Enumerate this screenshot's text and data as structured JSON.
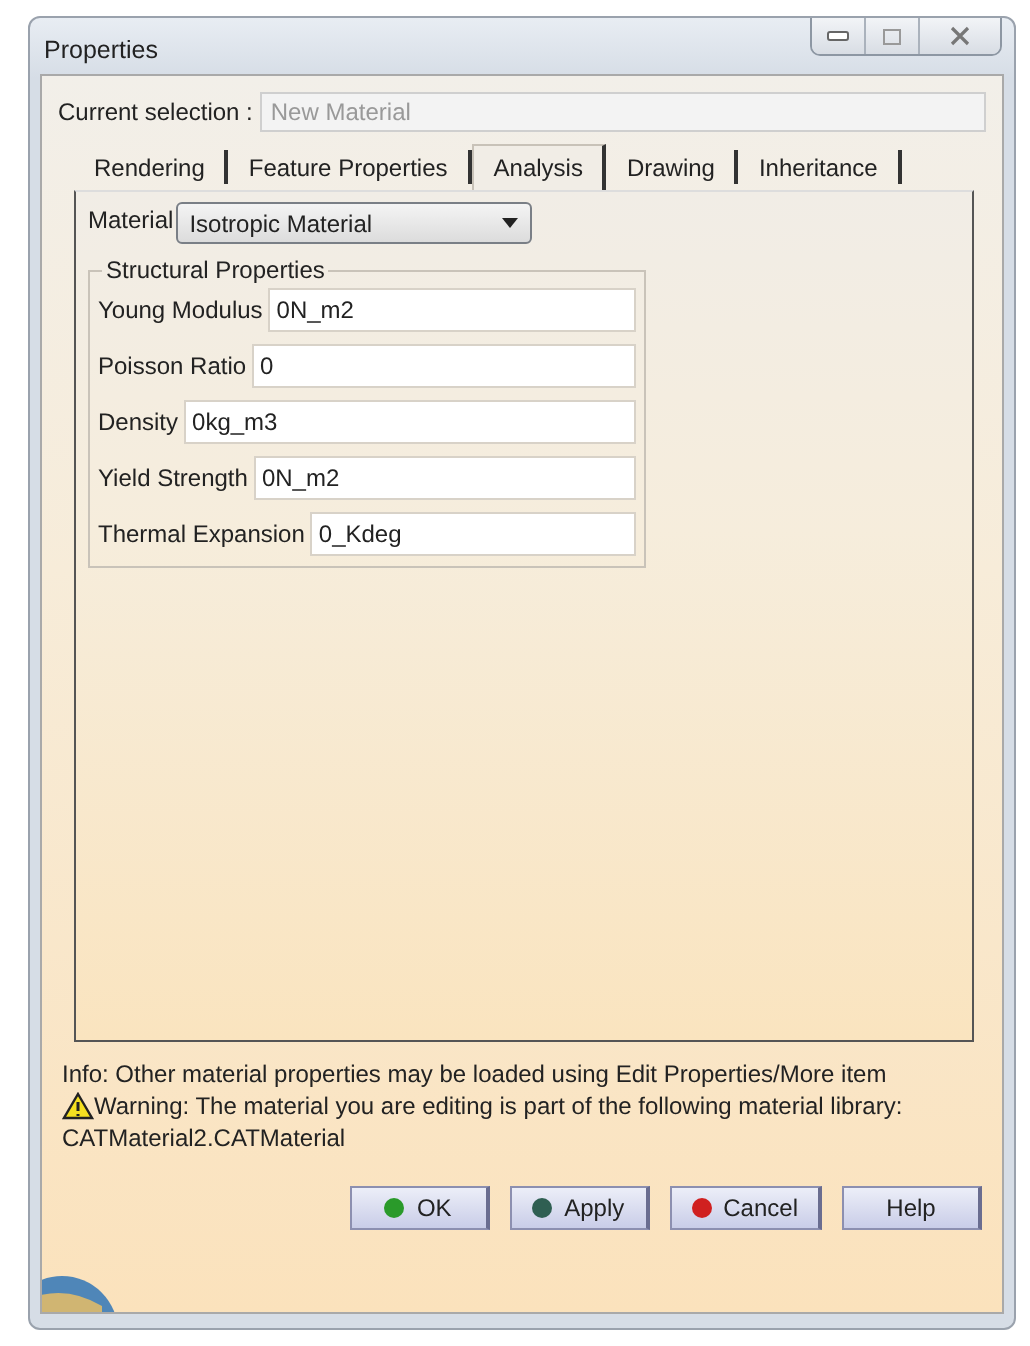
{
  "window": {
    "title": "Properties"
  },
  "current_selection": {
    "label": "Current selection :",
    "value": "New Material"
  },
  "tabs": [
    {
      "label": "Rendering",
      "selected": false
    },
    {
      "label": "Feature Properties",
      "selected": false
    },
    {
      "label": "Analysis",
      "selected": true
    },
    {
      "label": "Drawing",
      "selected": false
    },
    {
      "label": "Inheritance",
      "selected": false
    }
  ],
  "material": {
    "label": "Material",
    "value": "Isotropic Material"
  },
  "group": {
    "title": "Structural Properties",
    "fields": [
      {
        "label": "Young Modulus",
        "value": "0N_m2"
      },
      {
        "label": "Poisson Ratio",
        "value": "0"
      },
      {
        "label": "Density",
        "value": "0kg_m3"
      },
      {
        "label": "Yield Strength",
        "value": "0N_m2"
      },
      {
        "label": "Thermal Expansion",
        "value": "0_Kdeg"
      }
    ]
  },
  "info": "Info: Other material properties may be loaded using Edit Properties/More item",
  "warning": "Warning: The material you are editing is part of the following material library:",
  "library": "CATMaterial2.CATMaterial",
  "buttons": [
    {
      "label": "OK",
      "color": "#2a9a2a"
    },
    {
      "label": "Apply",
      "color": "#2f5f52"
    },
    {
      "label": "Cancel",
      "color": "#d02020"
    },
    {
      "label": "Help"
    }
  ]
}
